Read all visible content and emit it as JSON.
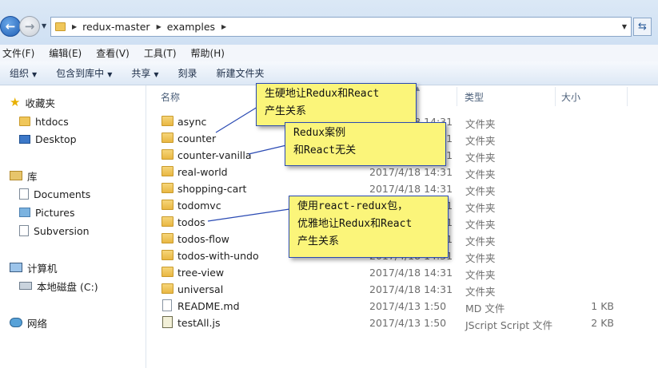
{
  "address": {
    "breadcrumbs": [
      "redux-master",
      "examples"
    ]
  },
  "menu": {
    "items": [
      "文件(F)",
      "编辑(E)",
      "查看(V)",
      "工具(T)",
      "帮助(H)"
    ]
  },
  "toolbar": {
    "organize": "组织",
    "include_in_library": "包含到库中",
    "share": "共享",
    "burn": "刻录",
    "new_folder": "新建文件夹"
  },
  "nav": {
    "favorites": "收藏夹",
    "htdocs": "htdocs",
    "desktop": "Desktop",
    "libraries": "库",
    "documents": "Documents",
    "pictures": "Pictures",
    "subversion": "Subversion",
    "computer": "计算机",
    "local_disk": "本地磁盘 (C:)",
    "network": "网络"
  },
  "columns": {
    "name": "名称",
    "type": "类型",
    "size": "大小"
  },
  "files": [
    {
      "name": "async",
      "date": "2017/4/18 14:31",
      "type": "文件夹",
      "size": "",
      "kind": "folder"
    },
    {
      "name": "counter",
      "date": "2017/4/18 14:31",
      "type": "文件夹",
      "size": "",
      "kind": "folder"
    },
    {
      "name": "counter-vanilla",
      "date": "2017/4/18 14:31",
      "type": "文件夹",
      "size": "",
      "kind": "folder"
    },
    {
      "name": "real-world",
      "date": "2017/4/18 14:31",
      "type": "文件夹",
      "size": "",
      "kind": "folder"
    },
    {
      "name": "shopping-cart",
      "date": "2017/4/18 14:31",
      "type": "文件夹",
      "size": "",
      "kind": "folder"
    },
    {
      "name": "todomvc",
      "date": "2017/4/18 14:31",
      "type": "文件夹",
      "size": "",
      "kind": "folder"
    },
    {
      "name": "todos",
      "date": "2017/4/18 14:31",
      "type": "文件夹",
      "size": "",
      "kind": "folder"
    },
    {
      "name": "todos-flow",
      "date": "2017/4/18 14:31",
      "type": "文件夹",
      "size": "",
      "kind": "folder"
    },
    {
      "name": "todos-with-undo",
      "date": "2017/4/18 14:31",
      "type": "文件夹",
      "size": "",
      "kind": "folder"
    },
    {
      "name": "tree-view",
      "date": "2017/4/18 14:31",
      "type": "文件夹",
      "size": "",
      "kind": "folder"
    },
    {
      "name": "universal",
      "date": "2017/4/18 14:31",
      "type": "文件夹",
      "size": "",
      "kind": "folder"
    },
    {
      "name": "README.md",
      "date": "2017/4/13 1:50",
      "type": "MD 文件",
      "size": "1 KB",
      "kind": "doc"
    },
    {
      "name": "testAll.js",
      "date": "2017/4/13 1:50",
      "type": "JScript Script 文件",
      "size": "2 KB",
      "kind": "js"
    }
  ],
  "callouts": {
    "first": [
      "生硬地让Redux和React",
      "产生关系"
    ],
    "second": [
      "Redux案例",
      "和React无关"
    ],
    "third": [
      "使用react-redux包，",
      "优雅地让Redux和React",
      "产生关系"
    ]
  },
  "colors": {
    "callout_bg": "#fbf57a",
    "callout_border": "#2a4ab3",
    "accent": "#1f5fb5"
  }
}
